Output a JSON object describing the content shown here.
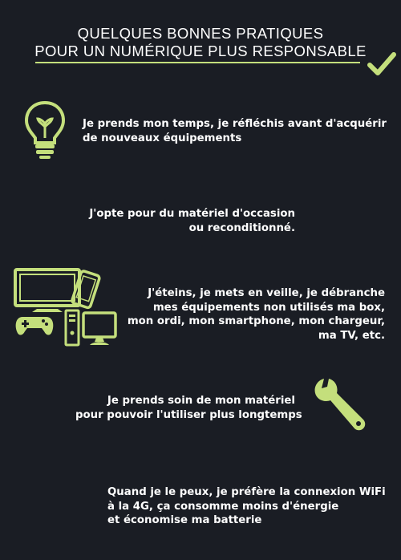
{
  "header": {
    "title_line1": "QUELQUES BONNES PRATIQUES",
    "title_line2": "POUR UN NUMÉRIQUE PLUS RESPONSABLE"
  },
  "tips": [
    {
      "text": "Je prends mon temps, je réfléchis avant d'acquérir\nde nouveaux équipements",
      "icon": "lightbulb-icon"
    },
    {
      "text": "J'opte pour du matériel d'occasion\nou reconditionné."
    },
    {
      "text": "J'éteins, je mets en veille, je débranche\nmes équipements non utilisés ma box,\nmon ordi, mon smartphone, mon chargeur,\nma TV, etc.",
      "icon": "devices-icon"
    },
    {
      "text": "Je prends soin de mon matériel\npour pouvoir l'utiliser plus longtemps",
      "icon": "wrench-icon"
    },
    {
      "text": "Quand je le peux, je préfère la connexion WiFi\nà la 4G, ça consomme moins d'énergie\net économise ma batterie"
    }
  ],
  "colors": {
    "accent": "#c4df7c",
    "background": "#1a1d24",
    "text": "#ffffff"
  }
}
